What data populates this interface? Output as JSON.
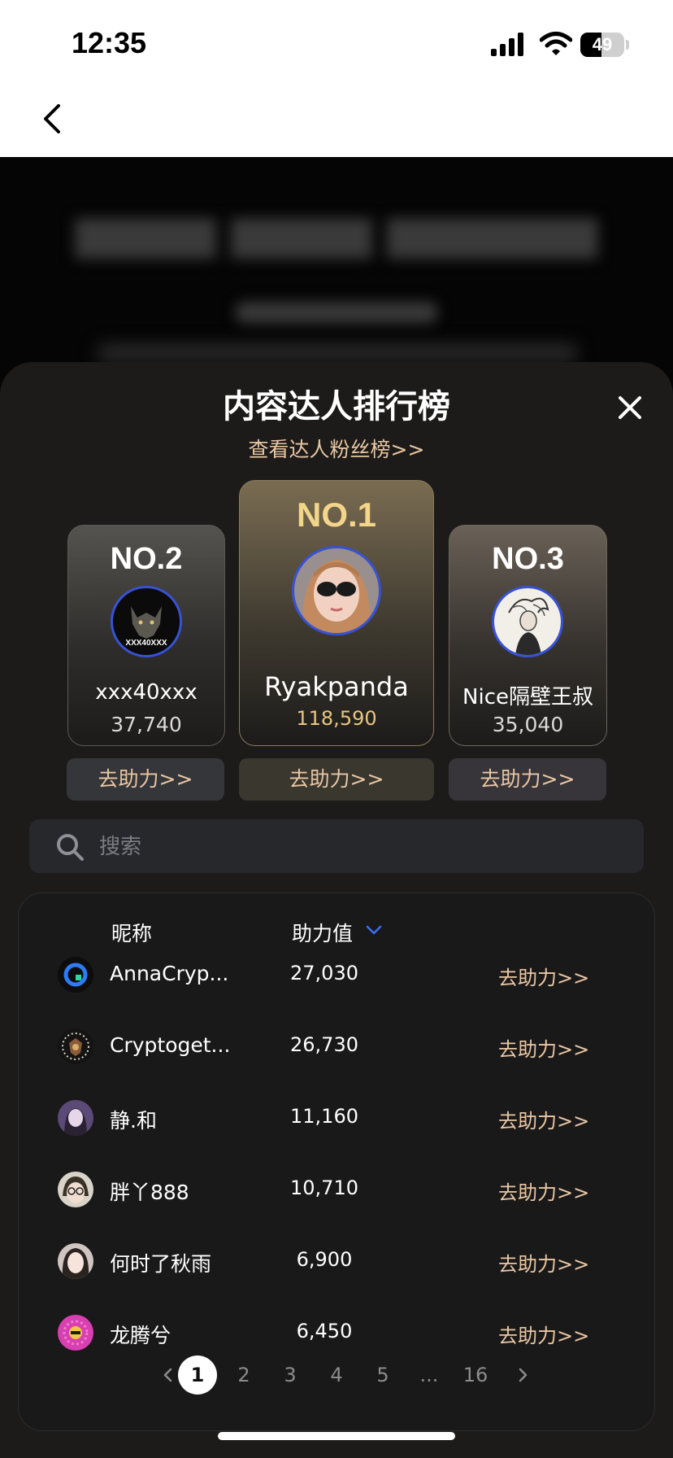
{
  "status_bar": {
    "time": "12:35",
    "battery_level": "49",
    "battery_fraction": 0.49
  },
  "nav": {
    "back_icon": "chevron-left-icon"
  },
  "sheet": {
    "title": "内容达人排行榜",
    "fans_link": "查看达人粉丝榜>>",
    "close_icon": "close-icon"
  },
  "podium": [
    {
      "rank": "NO.1",
      "name": "Ryakpanda",
      "score": "118,590",
      "button": "去助力>>"
    },
    {
      "rank": "NO.2",
      "name": "xxx40xxx",
      "avatar_text": "XXX40XXX",
      "score": "37,740",
      "button": "去助力>>"
    },
    {
      "rank": "NO.3",
      "name": "Nice隔壁王叔",
      "score": "35,040",
      "button": "去助力>>"
    }
  ],
  "search": {
    "placeholder": "搜索",
    "icon": "search-icon"
  },
  "table": {
    "headers": {
      "nickname": "昵称",
      "score": "助力值"
    },
    "sort_icon": "chevron-down-icon",
    "rows": [
      {
        "name": "AnnaCryp...",
        "value": "27,030",
        "action": "去助力>>"
      },
      {
        "name": "Cryptoget...",
        "value": "26,730",
        "action": "去助力>>"
      },
      {
        "name": "静.和",
        "value": "11,160",
        "action": "去助力>>"
      },
      {
        "name": "胖丫888",
        "value": "10,710",
        "action": "去助力>>"
      },
      {
        "name": "何时了秋雨",
        "value": "6,900",
        "action": "去助力>>"
      },
      {
        "name": "龙腾兮",
        "value": "6,450",
        "action": "去助力>>"
      }
    ]
  },
  "pagination": {
    "pages": [
      "1",
      "2",
      "3",
      "4",
      "5",
      "...",
      "16"
    ],
    "current": "1"
  },
  "colors": {
    "accent_gold": "#e9c7a4",
    "top_rank_gold": "#f3d58b",
    "sort_blue": "#3b6ff5",
    "avatar_ring": "#3752d8"
  }
}
